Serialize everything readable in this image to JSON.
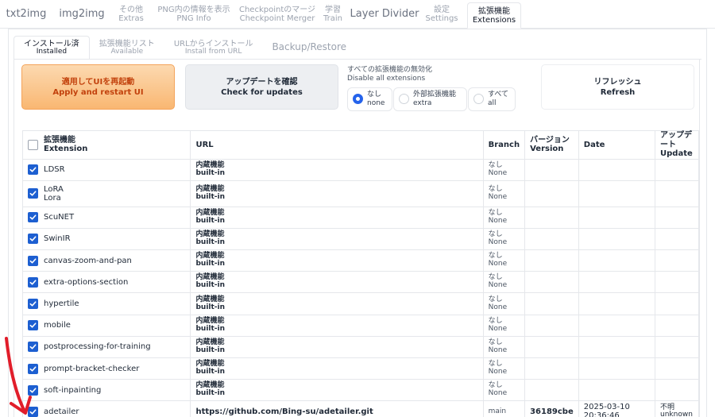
{
  "top_tabs": [
    {
      "label": "txt2img"
    },
    {
      "label": "img2img"
    },
    {
      "jp": "その他",
      "en": "Extras"
    },
    {
      "jp": "PNG内の情報を表示",
      "en": "PNG Info"
    },
    {
      "jp": "Checkpointのマージ",
      "en": "Checkpoint Merger"
    },
    {
      "jp": "学習",
      "en": "Train"
    },
    {
      "label": "Layer Divider"
    },
    {
      "jp": "設定",
      "en": "Settings"
    },
    {
      "jp": "拡張機能",
      "en": "Extensions"
    }
  ],
  "sub_tabs": [
    {
      "jp": "インストール済",
      "en": "Installed"
    },
    {
      "jp": "拡張機能リスト",
      "en": "Available"
    },
    {
      "jp": "URLからインストール",
      "en": "Install from URL"
    },
    {
      "label": "Backup/Restore"
    }
  ],
  "buttons": {
    "apply": {
      "jp": "適用してUIを再起動",
      "en": "Apply and restart UI"
    },
    "update": {
      "jp": "アップデートを確認",
      "en": "Check for updates"
    },
    "refresh": {
      "jp": "リフレッシュ",
      "en": "Refresh"
    }
  },
  "disable_all": {
    "title_jp": "すべての拡張機能の無効化",
    "title_en": "Disable all extensions",
    "options": [
      {
        "jp": "なし",
        "en": "none"
      },
      {
        "jp": "外部拡張機能",
        "en": "extra"
      },
      {
        "jp": "すべて",
        "en": "all"
      }
    ]
  },
  "table": {
    "headers": {
      "extension_jp": "拡張機能",
      "extension_en": "Extension",
      "url": "URL",
      "branch": "Branch",
      "version_jp": "バージョン",
      "version_en": "Version",
      "date": "Date",
      "update_jp": "アップデート",
      "update_en": "Update"
    },
    "builtin_jp": "内蔵機能",
    "builtin_en": "built-in",
    "branch_none_jp": "なし",
    "branch_none_en": "None",
    "rows": [
      {
        "name": "LDSR"
      },
      {
        "name": "LoRA",
        "subname": "Lora"
      },
      {
        "name": "ScuNET"
      },
      {
        "name": "SwinIR"
      },
      {
        "name": "canvas-zoom-and-pan"
      },
      {
        "name": "extra-options-section"
      },
      {
        "name": "hypertile"
      },
      {
        "name": "mobile"
      },
      {
        "name": "postprocessing-for-training"
      },
      {
        "name": "prompt-bracket-checker"
      },
      {
        "name": "soft-inpainting"
      }
    ],
    "last_row": {
      "name": "adetailer",
      "url": "https://github.com/Bing-su/adetailer.git",
      "branch": "main",
      "version": "36189cbe",
      "date": "2025-03-10 20:36:46",
      "update_jp": "不明",
      "update_en": "unknown"
    }
  },
  "colors": {
    "annotation_arrow": "#e11d2a",
    "checkbox": "#1d5fd1",
    "apply_button": "#f9b772"
  }
}
